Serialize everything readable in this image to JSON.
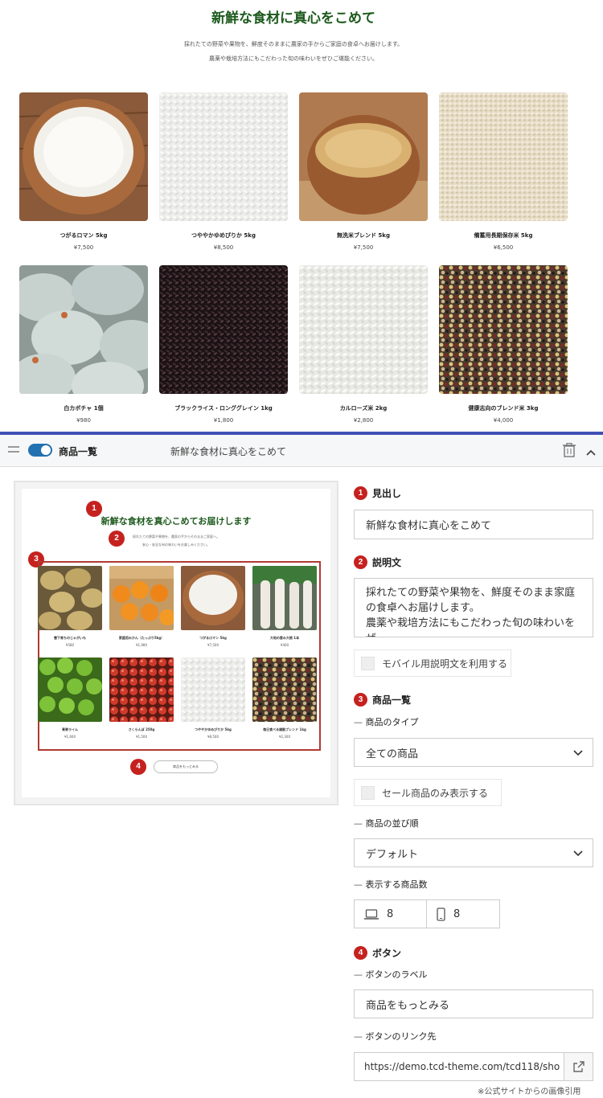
{
  "storefront": {
    "heading": "新鮮な食材に真心をこめて",
    "description_line1": "採れたての野菜や果物を、鮮度そのままに農家の手からご家庭の食卓へお届けします。",
    "description_line2": "農薬や栽培方法にもこだわった旬の味わいをぜひご堪能ください。",
    "products": [
      {
        "name": "つがるロマン 5kg",
        "price": "¥7,500",
        "image": "white-rice-bowl"
      },
      {
        "name": "つややかゆめぴりか 5kg",
        "price": "¥8,500",
        "image": "white-rice-closeup"
      },
      {
        "name": "無洗米ブレンド 5kg",
        "price": "¥7,500",
        "image": "brown-rice-bowl"
      },
      {
        "name": "備蓄用長期保存米 5kg",
        "price": "¥6,500",
        "image": "mixed-grain-closeup"
      },
      {
        "name": "白カボチャ 1個",
        "price": "¥980",
        "image": "white-pumpkins"
      },
      {
        "name": "ブラックライス・ロンググレイン 1kg",
        "price": "¥1,800",
        "image": "black-rice"
      },
      {
        "name": "カルローズ米 2kg",
        "price": "¥2,800",
        "image": "calrose-rice"
      },
      {
        "name": "健康志向のブレンド米 3kg",
        "price": "¥4,000",
        "image": "grain-blend"
      }
    ]
  },
  "admin": {
    "section_title": "商品一覧",
    "section_subtitle": "新鮮な食材に真心をこめて",
    "preview": {
      "title": "新鮮な食材を真心こめてお届けします",
      "desc_line1": "採れたての野菜や果物を、農家の手からそのままご家庭へ。",
      "desc_line2": "安心・安全な旬の味わいをお楽しみください。",
      "badges": [
        "1",
        "2",
        "3",
        "4"
      ],
      "products": [
        {
          "name": "雪下育ちのじゃがいも",
          "price": "¥580",
          "image": "potatoes"
        },
        {
          "name": "家庭用みかん（たっぷり5kg）",
          "price": "¥1,980",
          "image": "mandarins"
        },
        {
          "name": "つがるロマン 5kg",
          "price": "¥7,500",
          "image": "white-rice-bowl"
        },
        {
          "name": "大地の恵み大根 1本",
          "price": "¥400",
          "image": "daikon"
        },
        {
          "name": "青果ライム",
          "price": "¥1,600",
          "image": "limes"
        },
        {
          "name": "さくらんぼ 250g",
          "price": "¥1,500",
          "image": "cherries"
        },
        {
          "name": "つややかゆめぴりか 5kg",
          "price": "¥8,500",
          "image": "white-rice-closeup"
        },
        {
          "name": "毎日食べる雑穀ブレンド 1kg",
          "price": "¥2,300",
          "image": "grain-blend"
        }
      ],
      "more_button": "商品をもっとみる"
    },
    "form": {
      "heading_label": "見出し",
      "heading_value": "新鮮な食材に真心をこめて",
      "desc_label": "説明文",
      "desc_value_line1": "採れたての野菜や果物を、鮮度そのまま家庭",
      "desc_value_line2": "の食卓へお届けします。",
      "desc_value_line3": "農薬や栽培方法にもこだわった旬の味わいをぜ",
      "mobile_desc_checkbox": "モバイル用説明文を利用する",
      "list_label": "商品一覧",
      "type_label": "商品のタイプ",
      "type_value": "全ての商品",
      "sale_only_checkbox": "セール商品のみ表示する",
      "order_label": "商品の並び順",
      "order_value": "デフォルト",
      "count_label": "表示する商品数",
      "count_desktop": "8",
      "count_mobile": "8",
      "button_label": "ボタン",
      "button_text_label": "ボタンのラベル",
      "button_text_value": "商品をもっとみる",
      "button_link_label": "ボタンのリンク先",
      "button_link_value": "https://demo.tcd-theme.com/tcd118/sho",
      "numbers": [
        "1",
        "2",
        "3",
        "4"
      ]
    },
    "credit": "※公式サイトからの画像引用"
  },
  "colors": {
    "heading_green": "#1d5a1d",
    "divider_blue": "#3f51b5",
    "badge_red": "#c5221f",
    "toggle_blue": "#2271b1"
  }
}
